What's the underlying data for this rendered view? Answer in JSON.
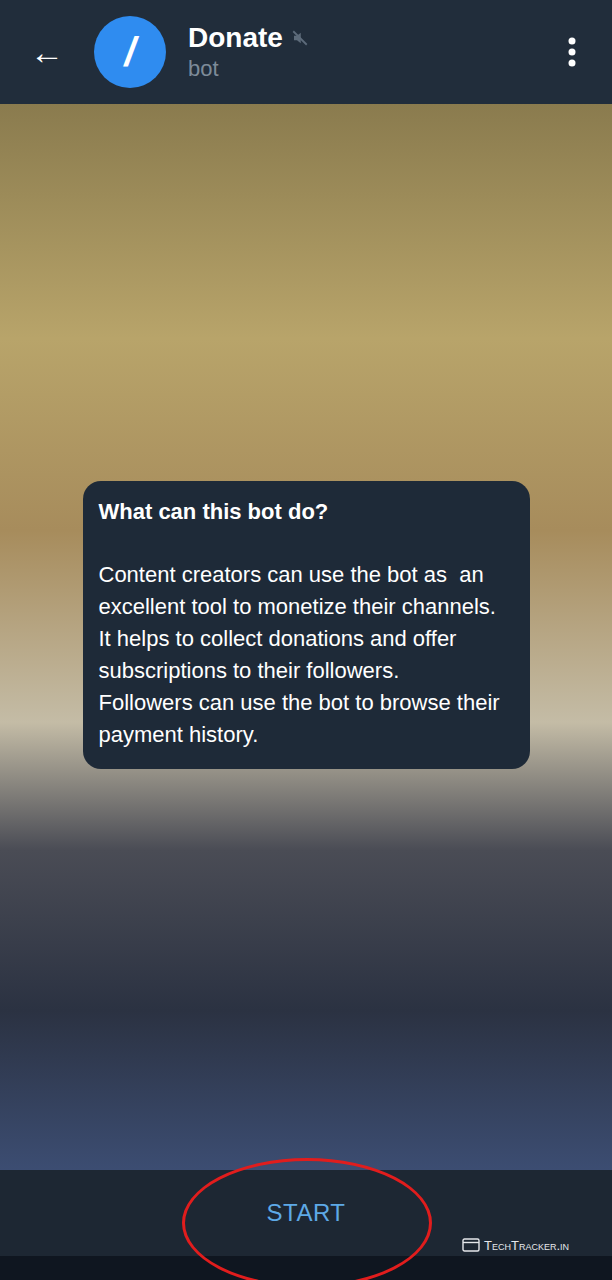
{
  "header": {
    "back_icon": "←",
    "avatar": "/",
    "title": "Donate",
    "muted": true,
    "subtitle": "bot"
  },
  "intro_card": {
    "title": "What can this bot do?",
    "description": "Content creators can use the bot as  an excellent tool to monetize their channels. It helps to collect donations and offer subscriptions to their followers.\nFollowers can use the bot to browse their payment history."
  },
  "bottom_bar": {
    "button": "START"
  },
  "watermark": {
    "text": "TechTracker.in"
  }
}
